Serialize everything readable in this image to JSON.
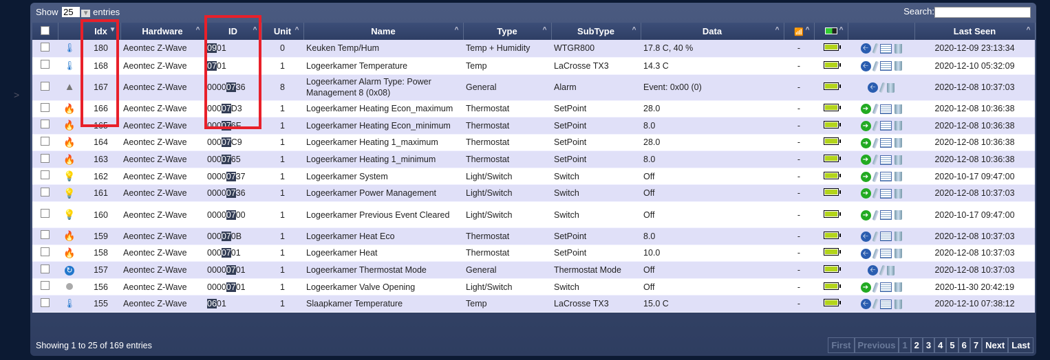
{
  "top": {
    "show_label": "Show",
    "page_size": "25",
    "entries_label": "entries",
    "search_label": "Search:",
    "search_value": ""
  },
  "columns": [
    "",
    "",
    "Idx",
    "Hardware",
    "ID",
    "Unit",
    "Name",
    "Type",
    "SubType",
    "Data",
    "signal-icon",
    "battery-icon",
    "",
    "Last Seen"
  ],
  "rows": [
    {
      "idx": "180",
      "hw": "Aeontec Z-Wave",
      "id": [
        "",
        "09",
        "01"
      ],
      "unit": "0",
      "name": "Keuken Temp/Hum",
      "type": "Temp + Humidity",
      "subtype": "WTGR800",
      "data": "17.8 C, 40 %",
      "signal": "-",
      "icon": "thermometer",
      "action": "blue",
      "log": true,
      "seen": "2020-12-09 23:13:34"
    },
    {
      "idx": "168",
      "hw": "Aeontec Z-Wave",
      "id": [
        "",
        "07",
        "01"
      ],
      "unit": "1",
      "name": "Logeerkamer Temperature",
      "type": "Temp",
      "subtype": "LaCrosse TX3",
      "data": "14.3 C",
      "signal": "-",
      "icon": "thermometer",
      "action": "blue",
      "log": true,
      "seen": "2020-12-10 05:32:09"
    },
    {
      "idx": "167",
      "hw": "Aeontec Z-Wave",
      "id": [
        "0000",
        "07",
        "36"
      ],
      "unit": "8",
      "name": "Logeerkamer Alarm Type: Power Management 8 (0x08)",
      "type": "General",
      "subtype": "Alarm",
      "data": "Event: 0x00 (0)",
      "signal": "-",
      "icon": "warning",
      "action": "blue",
      "log": false,
      "seen": "2020-12-08 10:37:03"
    },
    {
      "idx": "166",
      "hw": "Aeontec Z-Wave",
      "id": [
        "000",
        "07",
        "D3"
      ],
      "unit": "1",
      "name": "Logeerkamer Heating Econ_maximum",
      "type": "Thermostat",
      "subtype": "SetPoint",
      "data": "28.0",
      "signal": "-",
      "icon": "flame",
      "action": "green",
      "log": true,
      "seen": "2020-12-08 10:36:38"
    },
    {
      "idx": "165",
      "hw": "Aeontec Z-Wave",
      "id": [
        "000",
        "07",
        "6F"
      ],
      "unit": "1",
      "name": "Logeerkamer Heating Econ_minimum",
      "type": "Thermostat",
      "subtype": "SetPoint",
      "data": "8.0",
      "signal": "-",
      "icon": "flame",
      "action": "green",
      "log": true,
      "seen": "2020-12-08 10:36:38"
    },
    {
      "idx": "164",
      "hw": "Aeontec Z-Wave",
      "id": [
        "000",
        "07",
        "C9"
      ],
      "unit": "1",
      "name": "Logeerkamer Heating 1_maximum",
      "type": "Thermostat",
      "subtype": "SetPoint",
      "data": "28.0",
      "signal": "-",
      "icon": "flame",
      "action": "green",
      "log": true,
      "seen": "2020-12-08 10:36:38"
    },
    {
      "idx": "163",
      "hw": "Aeontec Z-Wave",
      "id": [
        "000",
        "07",
        "65"
      ],
      "unit": "1",
      "name": "Logeerkamer Heating 1_minimum",
      "type": "Thermostat",
      "subtype": "SetPoint",
      "data": "8.0",
      "signal": "-",
      "icon": "flame",
      "action": "green",
      "log": true,
      "seen": "2020-12-08 10:36:38"
    },
    {
      "idx": "162",
      "hw": "Aeontec Z-Wave",
      "id": [
        "0000",
        "07",
        "37"
      ],
      "unit": "1",
      "name": "Logeerkamer System",
      "type": "Light/Switch",
      "subtype": "Switch",
      "data": "Off",
      "signal": "-",
      "icon": "bulb",
      "action": "green",
      "log": true,
      "seen": "2020-10-17 09:47:00"
    },
    {
      "idx": "161",
      "hw": "Aeontec Z-Wave",
      "id": [
        "0000",
        "07",
        "36"
      ],
      "unit": "1",
      "name": "Logeerkamer Power Management",
      "type": "Light/Switch",
      "subtype": "Switch",
      "data": "Off",
      "signal": "-",
      "icon": "bulb",
      "action": "green",
      "log": true,
      "seen": "2020-12-08 10:37:03"
    },
    {
      "idx": "160",
      "hw": "Aeontec Z-Wave",
      "id": [
        "0000",
        "07",
        "00"
      ],
      "unit": "1",
      "name": "Logeerkamer Previous Event Cleared",
      "type": "Light/Switch",
      "subtype": "Switch",
      "data": "Off",
      "signal": "-",
      "icon": "bulb",
      "action": "green",
      "log": true,
      "seen": "2020-10-17 09:47:00"
    },
    {
      "idx": "159",
      "hw": "Aeontec Z-Wave",
      "id": [
        "000",
        "07",
        "0B"
      ],
      "unit": "1",
      "name": "Logeerkamer Heat Eco",
      "type": "Thermostat",
      "subtype": "SetPoint",
      "data": "8.0",
      "signal": "-",
      "icon": "flame",
      "action": "blue",
      "log": true,
      "seen": "2020-12-08 10:37:03"
    },
    {
      "idx": "158",
      "hw": "Aeontec Z-Wave",
      "id": [
        "000",
        "07",
        "01"
      ],
      "unit": "1",
      "name": "Logeerkamer Heat",
      "type": "Thermostat",
      "subtype": "SetPoint",
      "data": "10.0",
      "signal": "-",
      "icon": "flame",
      "action": "blue",
      "log": true,
      "seen": "2020-12-08 10:37:03"
    },
    {
      "idx": "157",
      "hw": "Aeontec Z-Wave",
      "id": [
        "0000",
        "07",
        "01"
      ],
      "unit": "1",
      "name": "Logeerkamer Thermostat Mode",
      "type": "General",
      "subtype": "Thermostat Mode",
      "data": "Off",
      "signal": "-",
      "icon": "refresh",
      "action": "blue",
      "log": false,
      "seen": "2020-12-08 10:37:03"
    },
    {
      "idx": "156",
      "hw": "Aeontec Z-Wave",
      "id": [
        "0000",
        "07",
        "01"
      ],
      "unit": "1",
      "name": "Logeerkamer Valve Opening",
      "type": "Light/Switch",
      "subtype": "Switch",
      "data": "Off",
      "signal": "-",
      "icon": "valve",
      "action": "green",
      "log": true,
      "seen": "2020-11-30 20:42:19"
    },
    {
      "idx": "155",
      "hw": "Aeontec Z-Wave",
      "id": [
        "",
        "06",
        "01"
      ],
      "unit": "1",
      "name": "Slaapkamer Temperature",
      "type": "Temp",
      "subtype": "LaCrosse TX3",
      "data": "15.0 C",
      "signal": "-",
      "icon": "thermometer",
      "action": "blue",
      "log": true,
      "seen": "2020-12-10 07:38:12"
    }
  ],
  "footer": {
    "info": "Showing 1 to 25 of 169 entries",
    "pager": [
      "First",
      "Previous",
      "1",
      "2",
      "3",
      "4",
      "5",
      "6",
      "7",
      "Next",
      "Last"
    ]
  },
  "colors": {
    "annotation": "#e8202a",
    "row_alt": "#e0e0f8",
    "header": "#3c4e78"
  }
}
